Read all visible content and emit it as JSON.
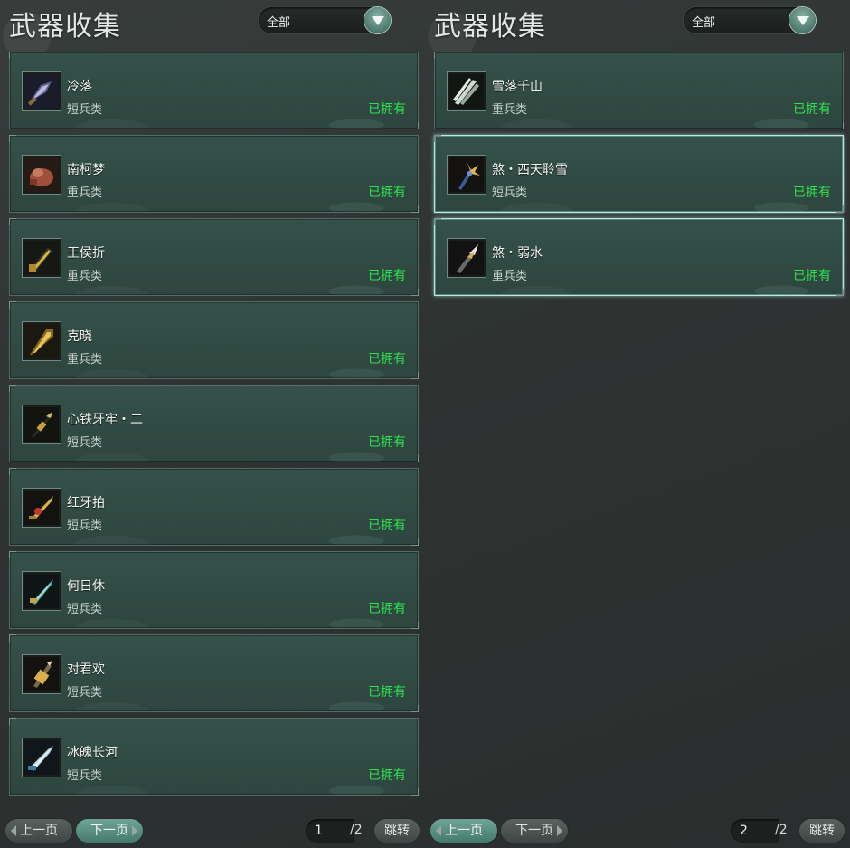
{
  "panels": [
    {
      "title": "武器收集",
      "filter": "全部",
      "items": [
        {
          "name": "冷落",
          "type": "短兵类",
          "status": "已拥有",
          "icon": "cleaver-icon"
        },
        {
          "name": "南柯梦",
          "type": "重兵类",
          "status": "已拥有",
          "icon": "gourd-icon"
        },
        {
          "name": "王侯折",
          "type": "重兵类",
          "status": "已拥有",
          "icon": "golden-blade-icon"
        },
        {
          "name": "克晓",
          "type": "重兵类",
          "status": "已拥有",
          "icon": "broad-sword-icon"
        },
        {
          "name": "心铁牙牢・二",
          "type": "短兵类",
          "status": "已拥有",
          "icon": "dagger-icon"
        },
        {
          "name": "红牙拍",
          "type": "短兵类",
          "status": "已拥有",
          "icon": "ornate-dagger-icon"
        },
        {
          "name": "何日休",
          "type": "短兵类",
          "status": "已拥有",
          "icon": "jade-dagger-icon"
        },
        {
          "name": "对君欢",
          "type": "短兵类",
          "status": "已拥有",
          "icon": "golden-hilt-icon"
        },
        {
          "name": "冰魄长河",
          "type": "短兵类",
          "status": "已拥有",
          "icon": "ice-blade-icon"
        }
      ],
      "pager": {
        "prev": "上一页",
        "next": "下一页",
        "current": "1",
        "total": "/2",
        "jump": "跳转",
        "active": "next"
      }
    },
    {
      "title": "武器收集",
      "filter": "全部",
      "items": [
        {
          "name": "雪落千山",
          "type": "重兵类",
          "status": "已拥有",
          "icon": "claw-blade-icon",
          "selected": false
        },
        {
          "name": "煞・西天聆雪",
          "type": "短兵类",
          "status": "已拥有",
          "icon": "trident-icon",
          "selected": true
        },
        {
          "name": "煞・弱水",
          "type": "重兵类",
          "status": "已拥有",
          "icon": "spear-icon",
          "selected": true
        }
      ],
      "pager": {
        "prev": "上一页",
        "next": "下一页",
        "current": "2",
        "total": "/2",
        "jump": "跳转",
        "active": "prev"
      }
    }
  ],
  "colors": {
    "owned": "#2ee04e",
    "card": "#355149",
    "accent": "#6fa596"
  }
}
